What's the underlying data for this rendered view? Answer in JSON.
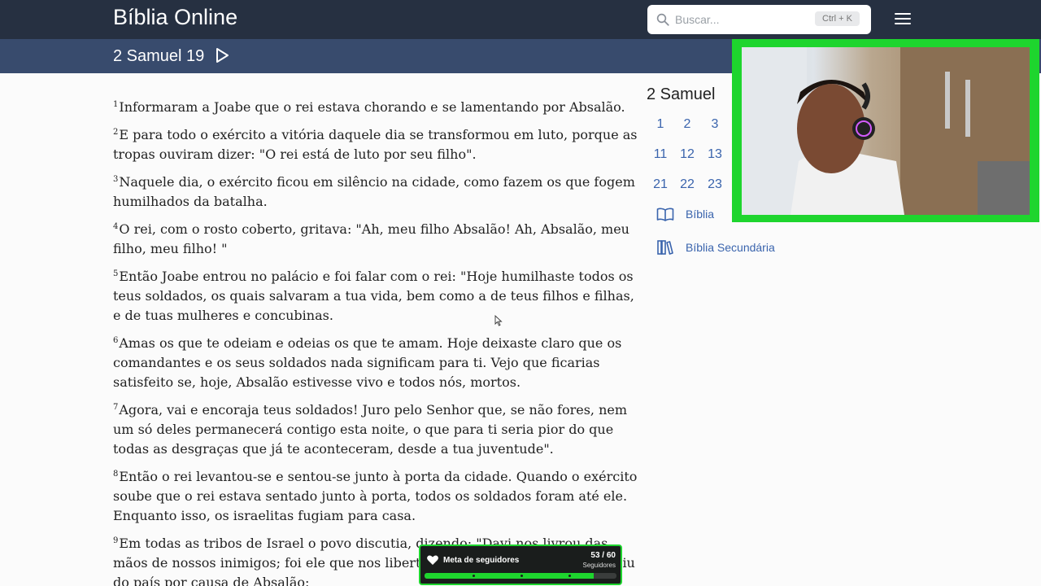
{
  "header": {
    "app_title": "Bíblia Online",
    "search_placeholder": "Buscar...",
    "search_shortcut": "Ctrl + K",
    "menu_icon": "hamburger-menu-icon"
  },
  "chapter_bar": {
    "title": "2 Samuel 19",
    "play_icon": "play-icon"
  },
  "verses": [
    {
      "num": "1",
      "text": "Informaram a Joabe que o rei estava chorando e se lamentando por Absalão."
    },
    {
      "num": "2",
      "text": "E para todo o exército a vitória daquele dia se transformou em luto, porque as tropas ouviram dizer: \"O rei está de luto por seu filho\"."
    },
    {
      "num": "3",
      "text": "Naquele dia, o exército ficou em silêncio na cidade, como fazem os que fogem humilhados da batalha."
    },
    {
      "num": "4",
      "text": "O rei, com o rosto coberto, gritava: \"Ah, meu filho Absalão! Ah, Absalão, meu filho, meu filho! \""
    },
    {
      "num": "5",
      "text": "Então Joabe entrou no palácio e foi falar com o rei: \"Hoje humilhaste todos os teus soldados, os quais salvaram a tua vida, bem como a de teus filhos e filhas, e de tuas mulheres e concubinas."
    },
    {
      "num": "6",
      "text": "Amas os que te odeiam e odeias os que te amam. Hoje deixaste claro que os comandantes e os seus soldados nada significam para ti. Vejo que ficarias satisfeito se, hoje, Absalão estivesse vivo e todos nós, mortos."
    },
    {
      "num": "7",
      "text": "Agora, vai e encoraja teus soldados! Juro pelo Senhor que, se não fores, nem um só deles permanecerá contigo esta noite, o que para ti seria pior do que todas as desgraças que já te aconteceram, desde a tua juventude\"."
    },
    {
      "num": "8",
      "text": "Então o rei levantou-se e sentou-se junto à porta da cidade. Quando o exército soube que o rei estava sentado junto à porta, todos os soldados foram até ele. Enquanto isso, os israelitas fugiam para casa."
    },
    {
      "num": "9",
      "text": "Em todas as tribos de Israel o povo discutia, dizendo: \"Davi nos livrou das mãos de nossos inimigos; foi ele que nos libertou dos filisteus, mas agora fugiu do país por causa de Absalão;"
    }
  ],
  "sidebar": {
    "book_title": "2 Samuel",
    "chapters": [
      "1",
      "2",
      "3",
      "11",
      "12",
      "13",
      "21",
      "22",
      "23"
    ],
    "links": [
      {
        "label": "Bíblia",
        "icon": "open-book-icon"
      },
      {
        "label": "Bíblia Secundária",
        "icon": "books-icon"
      }
    ]
  },
  "follower_goal": {
    "label": "Meta de seguidores",
    "count": "53 / 60",
    "unit": "Seguidores",
    "progress": 0.883,
    "icon": "heart-hand-icon",
    "accent": "#1ed52e"
  },
  "webcam": {
    "label": "webcam-overlay"
  }
}
